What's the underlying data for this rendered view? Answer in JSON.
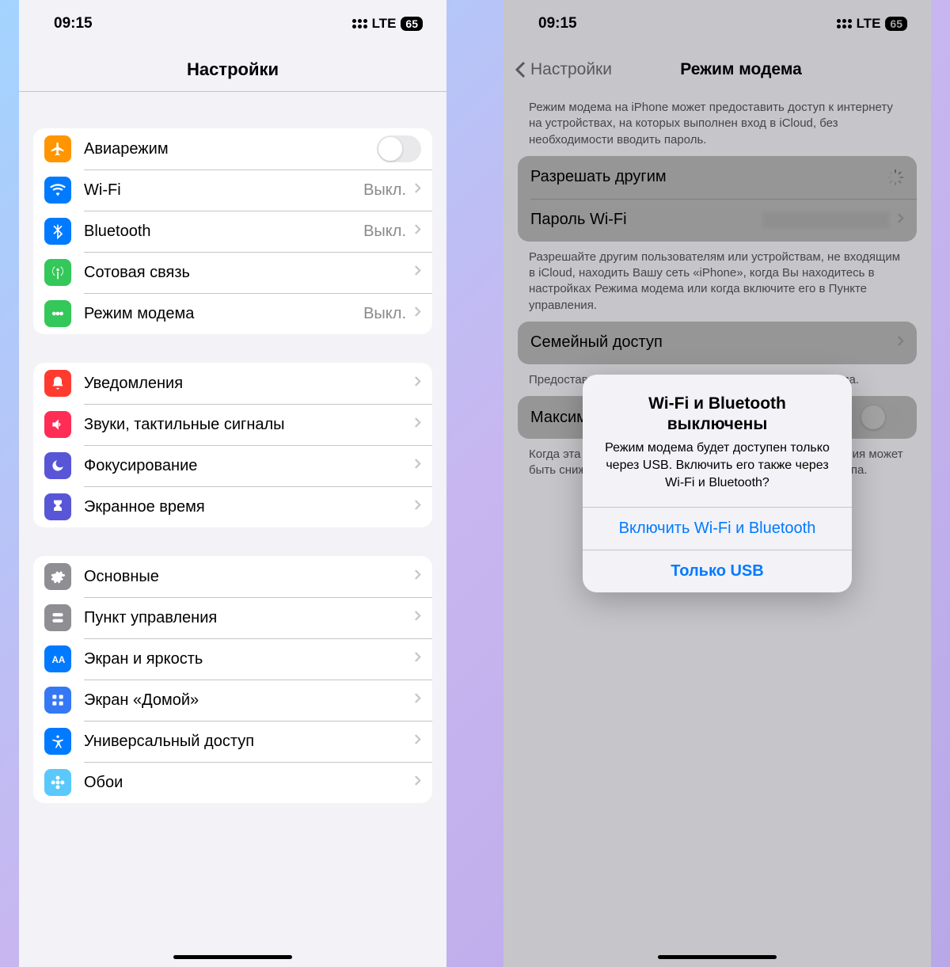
{
  "status": {
    "time": "09:15",
    "lte": "LTE",
    "battery": "65"
  },
  "left": {
    "title": "Настройки",
    "g1": [
      {
        "label": "Авиарежим",
        "icon": "airplane",
        "color": "ic-orange",
        "kind": "toggle"
      },
      {
        "label": "Wi-Fi",
        "icon": "wifi",
        "color": "ic-blue",
        "value": "Выкл."
      },
      {
        "label": "Bluetooth",
        "icon": "bluetooth",
        "color": "ic-bt",
        "value": "Выкл."
      },
      {
        "label": "Сотовая связь",
        "icon": "antenna",
        "color": "ic-green"
      },
      {
        "label": "Режим модема",
        "icon": "hotspot",
        "color": "ic-hotspot",
        "value": "Выкл."
      }
    ],
    "g2": [
      {
        "label": "Уведомления",
        "icon": "bell",
        "color": "ic-red"
      },
      {
        "label": "Звуки, тактильные сигналы",
        "icon": "speaker",
        "color": "ic-pink"
      },
      {
        "label": "Фокусирование",
        "icon": "moon",
        "color": "ic-purple"
      },
      {
        "label": "Экранное время",
        "icon": "hourglass",
        "color": "ic-indigo"
      }
    ],
    "g3": [
      {
        "label": "Основные",
        "icon": "gear",
        "color": "ic-gray"
      },
      {
        "label": "Пункт управления",
        "icon": "switches",
        "color": "ic-graylt"
      },
      {
        "label": "Экран и яркость",
        "icon": "aa",
        "color": "ic-blue2"
      },
      {
        "label": "Экран «Домой»",
        "icon": "grid",
        "color": "ic-bluedk"
      },
      {
        "label": "Универсальный доступ",
        "icon": "accessibility",
        "color": "ic-blue2"
      },
      {
        "label": "Обои",
        "icon": "flower",
        "color": "ic-cyan"
      }
    ]
  },
  "right": {
    "back": "Настройки",
    "title": "Режим модема",
    "desc1": "Режим модема на iPhone может предоставить доступ к интернету на устройствах, на которых выполнен вход в iCloud, без необходимости вводить пароль.",
    "allow": "Разрешать другим",
    "password_label": "Пароль Wi-Fi",
    "desc2": "Разрешайте другим пользователям или устройствам, не входящим в iCloud, находить Вашу сеть «iPhone», когда Вы находитесь в настройках Режима модема или когда включите его в Пункте управления.",
    "family": "Семейный доступ",
    "desc3": "Предоставьте членам семьи общий доступ к точке доступа.",
    "compat": "Максимальная совместимость",
    "desc4": "Когда эта функция включена, скорость интернет-соединения может быть снижена для устройств, подключенных к точке доступа.",
    "alert": {
      "title": "Wi-Fi и Bluetooth выключены",
      "msg": "Режим модема будет доступен только через USB. Включить его также через Wi-Fi и Bluetooth?",
      "btn1": "Включить Wi-Fi и Bluetooth",
      "btn2": "Только USB"
    }
  }
}
